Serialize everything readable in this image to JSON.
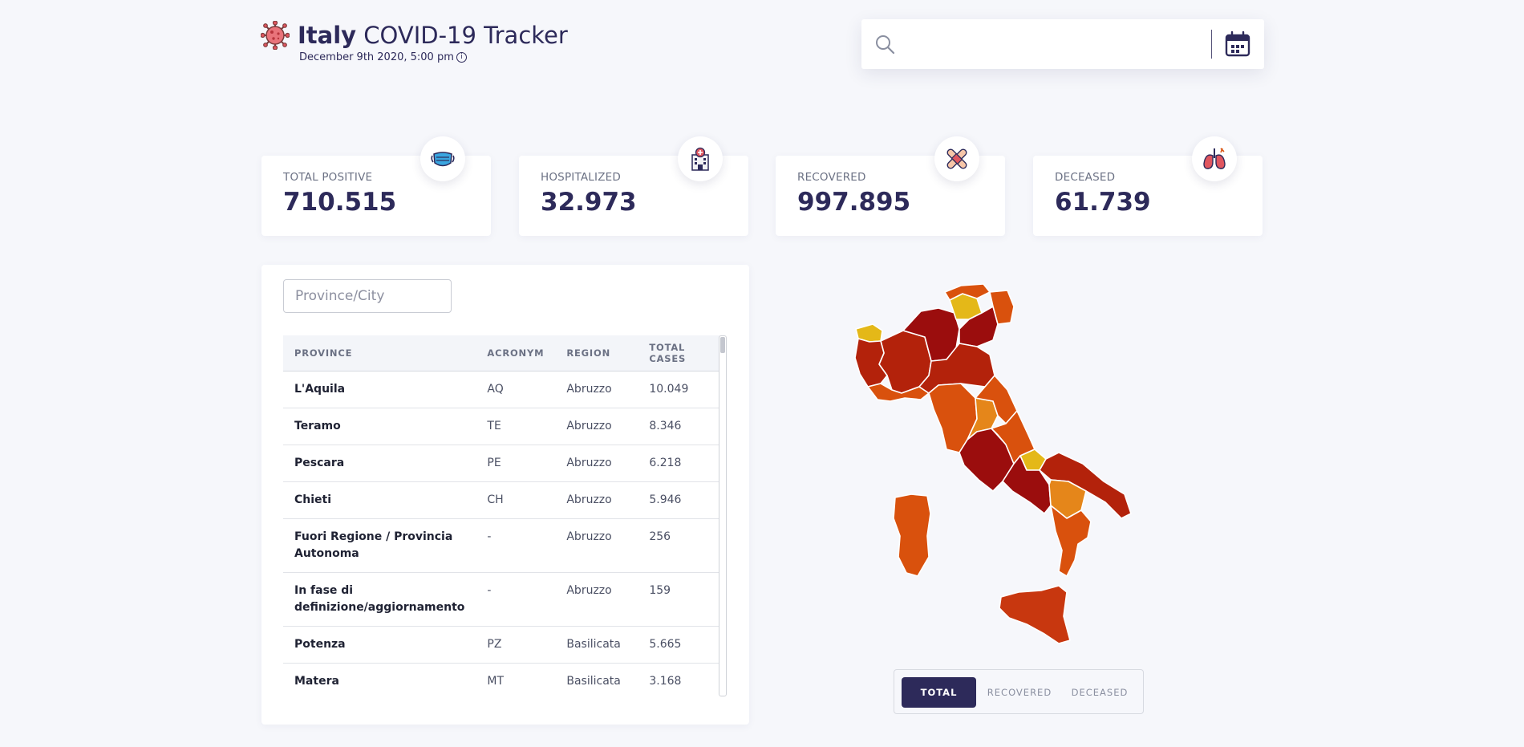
{
  "header": {
    "title_bold": "Italy",
    "title_rest": " COVID-19 Tracker",
    "date": "December 9th 2020, 5:00 pm",
    "info_glyph": "i"
  },
  "search": {
    "value": "",
    "placeholder": ""
  },
  "stats": [
    {
      "label": "TOTAL POSITIVE",
      "value": "710.515",
      "icon": "mask-icon"
    },
    {
      "label": "HOSPITALIZED",
      "value": "32.973",
      "icon": "hospital-icon"
    },
    {
      "label": "RECOVERED",
      "value": "997.895",
      "icon": "bandage-icon"
    },
    {
      "label": "DECEASED",
      "value": "61.739",
      "icon": "lungs-icon"
    }
  ],
  "table": {
    "filter_placeholder": "Province/City",
    "headers": [
      "PROVINCE",
      "ACRONYM",
      "REGION",
      "TOTAL CASES"
    ],
    "rows": [
      [
        "L'Aquila",
        "AQ",
        "Abruzzo",
        "10.049"
      ],
      [
        "Teramo",
        "TE",
        "Abruzzo",
        "8.346"
      ],
      [
        "Pescara",
        "PE",
        "Abruzzo",
        "6.218"
      ],
      [
        "Chieti",
        "CH",
        "Abruzzo",
        "5.946"
      ],
      [
        "Fuori Regione / Provincia Autonoma",
        "-",
        "Abruzzo",
        "256"
      ],
      [
        "In fase di definizione/aggiornamento",
        "-",
        "Abruzzo",
        "159"
      ],
      [
        "Potenza",
        "PZ",
        "Basilicata",
        "5.665"
      ],
      [
        "Matera",
        "MT",
        "Basilicata",
        "3.168"
      ]
    ]
  },
  "map_toggle": [
    "TOTAL",
    "RECOVERED",
    "DECEASED"
  ],
  "map_toggle_active": "TOTAL",
  "colors": {
    "primary": "#2d2a5a",
    "map_dark": "#9b0d0d",
    "map_red": "#b3220b",
    "map_orange_red": "#c8370f",
    "map_orange": "#d9510d",
    "map_light_orange": "#e5861a",
    "map_yellow": "#e4b818"
  }
}
